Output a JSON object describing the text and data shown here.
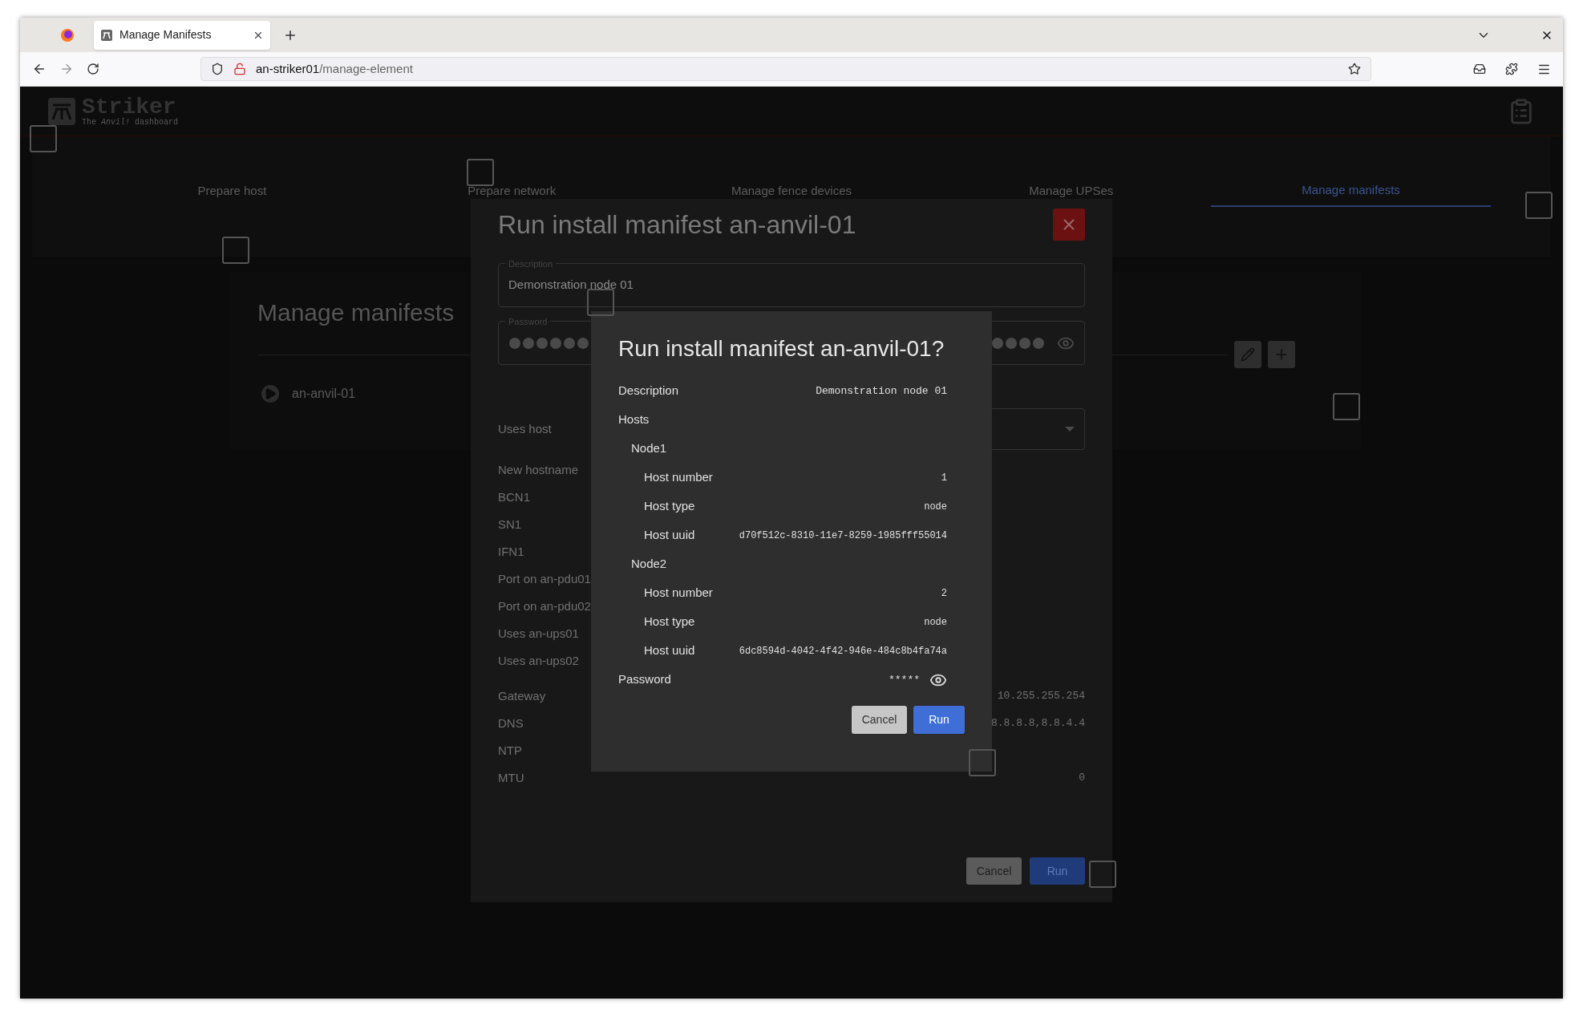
{
  "browser": {
    "tab_title": "Manage Manifests",
    "url_host": "an-striker01",
    "url_path": "/manage-element"
  },
  "app": {
    "logo_title": "Striker",
    "logo_subtitle": "The *Anvil!* dashboard"
  },
  "tabs": [
    {
      "label": "Prepare host",
      "selected": false
    },
    {
      "label": "Prepare network",
      "selected": false
    },
    {
      "label": "Manage fence devices",
      "selected": false
    },
    {
      "label": "Manage UPSes",
      "selected": false
    },
    {
      "label": "Manage manifests",
      "selected": true
    }
  ],
  "panel": {
    "title": "Manage manifests",
    "manifests": [
      {
        "name": "an-anvil-01"
      }
    ]
  },
  "edit_dialog": {
    "title": "Run install manifest an-anvil-01",
    "description": {
      "label": "Description",
      "value": "Demonstration node 01"
    },
    "password": {
      "label": "Password"
    },
    "host_rows": [
      {
        "label": "Uses host",
        "kind": "select"
      },
      {
        "label": "New hostname",
        "kind": "text"
      },
      {
        "label": "BCN1",
        "kind": "text"
      },
      {
        "label": "SN1",
        "kind": "text"
      },
      {
        "label": "IFN1",
        "kind": "text"
      },
      {
        "label": "Port on an-pdu01",
        "kind": "text"
      },
      {
        "label": "Port on an-pdu02",
        "kind": "text"
      },
      {
        "label": "Uses an-ups01",
        "kind": "text"
      },
      {
        "label": "Uses an-ups02",
        "kind": "text"
      }
    ],
    "network_rows": [
      {
        "label": "Gateway",
        "value": "10.255.255.254"
      },
      {
        "label": "DNS",
        "value": "8.8.8.8,8.8.4.4"
      },
      {
        "label": "NTP"
      },
      {
        "label": "MTU",
        "value": "0"
      }
    ],
    "buttons": [
      {
        "label": "Cancel",
        "kind": "cancel"
      },
      {
        "label": "Run",
        "kind": "run"
      }
    ]
  },
  "confirm_dialog": {
    "title": "Run install manifest an-anvil-01?",
    "description": {
      "label": "Description",
      "value": "Demonstration node 01"
    },
    "hosts_label": "Hosts",
    "hosts": [
      {
        "name": "Node1",
        "children": [
          {
            "label": "Host number",
            "value": "1"
          },
          {
            "label": "Host type",
            "value": "node"
          },
          {
            "label": "Host uuid",
            "value": "d70f512c-8310-11e7-8259-1985fff55014"
          }
        ]
      },
      {
        "name": "Node2",
        "children": [
          {
            "label": "Host number",
            "value": "2"
          },
          {
            "label": "Host type",
            "value": "node"
          },
          {
            "label": "Host uuid",
            "value": "6dc8594d-4042-4f42-946e-484c8b4fa74a"
          }
        ]
      }
    ],
    "password": {
      "label": "Password",
      "value": "*****"
    },
    "buttons": [
      {
        "label": "Cancel",
        "kind": "cancel"
      },
      {
        "label": "Run",
        "kind": "run"
      }
    ]
  }
}
